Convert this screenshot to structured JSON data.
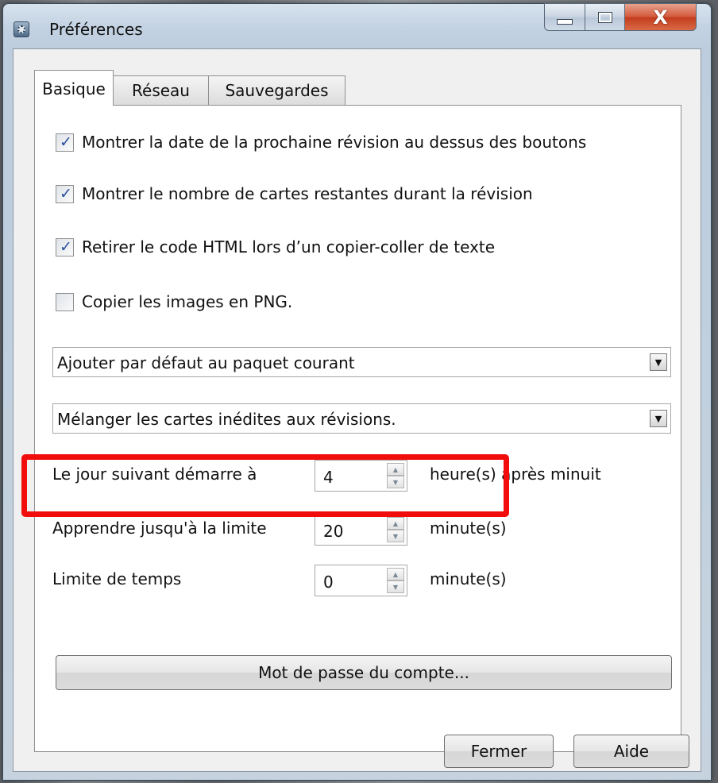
{
  "window": {
    "title": "Préférences",
    "close_symbol": "X"
  },
  "tabs": [
    {
      "label": "Basique",
      "active": true
    },
    {
      "label": "Réseau",
      "active": false
    },
    {
      "label": "Sauvegardes",
      "active": false
    }
  ],
  "checkboxes": [
    {
      "label": "Montrer la date de la prochaine révision au dessus des boutons",
      "checked": true
    },
    {
      "label": "Montrer le nombre de cartes restantes durant la révision",
      "checked": true
    },
    {
      "label": "Retirer le code HTML lors d’un copier-coller de texte",
      "checked": true
    },
    {
      "label": "Copier les images en PNG.",
      "checked": false
    }
  ],
  "check_symbol": "✓",
  "dropdowns": [
    {
      "selected": "Ajouter par défaut au paquet courant"
    },
    {
      "selected": "Mélanger les cartes inédites aux révisions."
    }
  ],
  "spinners": [
    {
      "label": "Le jour suivant démarre à",
      "value": "4",
      "unit": "heure(s) après minuit"
    },
    {
      "label": "Apprendre jusqu'à la limite",
      "value": "20",
      "unit": "minute(s)"
    },
    {
      "label": "Limite de temps",
      "value": "0",
      "unit": "minute(s)"
    }
  ],
  "account_password_button": "Mot de passe du compte...",
  "buttons": {
    "close": "Fermer",
    "help": "Aide"
  },
  "colors": {
    "highlight": "#f20d0d",
    "checkmark": "#2b4f9e"
  }
}
